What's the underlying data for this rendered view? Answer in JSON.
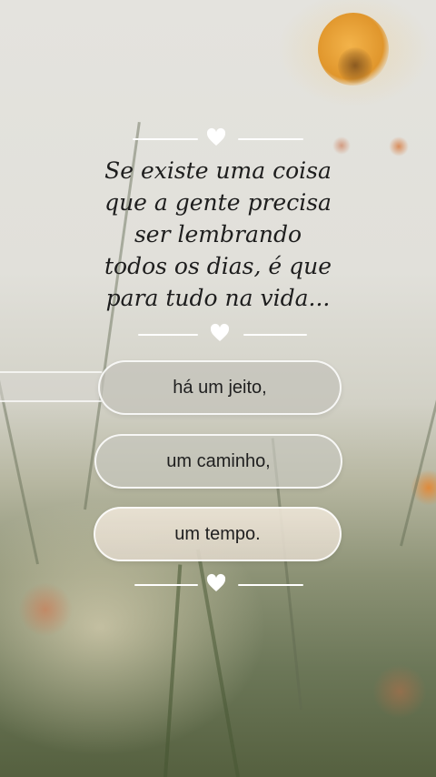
{
  "quote": {
    "lines": [
      "Se existe uma coisa",
      "que a gente precisa",
      "ser lembrando",
      "todos os dias, é  que",
      "para tudo na vida..."
    ]
  },
  "options": [
    {
      "label": "há um jeito,"
    },
    {
      "label": "um caminho,"
    },
    {
      "label": "um tempo."
    }
  ],
  "icons": {
    "divider": "heart-icon"
  },
  "colors": {
    "text": "#1d1d1d",
    "divider": "#ffffff",
    "flower": "#e3a531"
  }
}
